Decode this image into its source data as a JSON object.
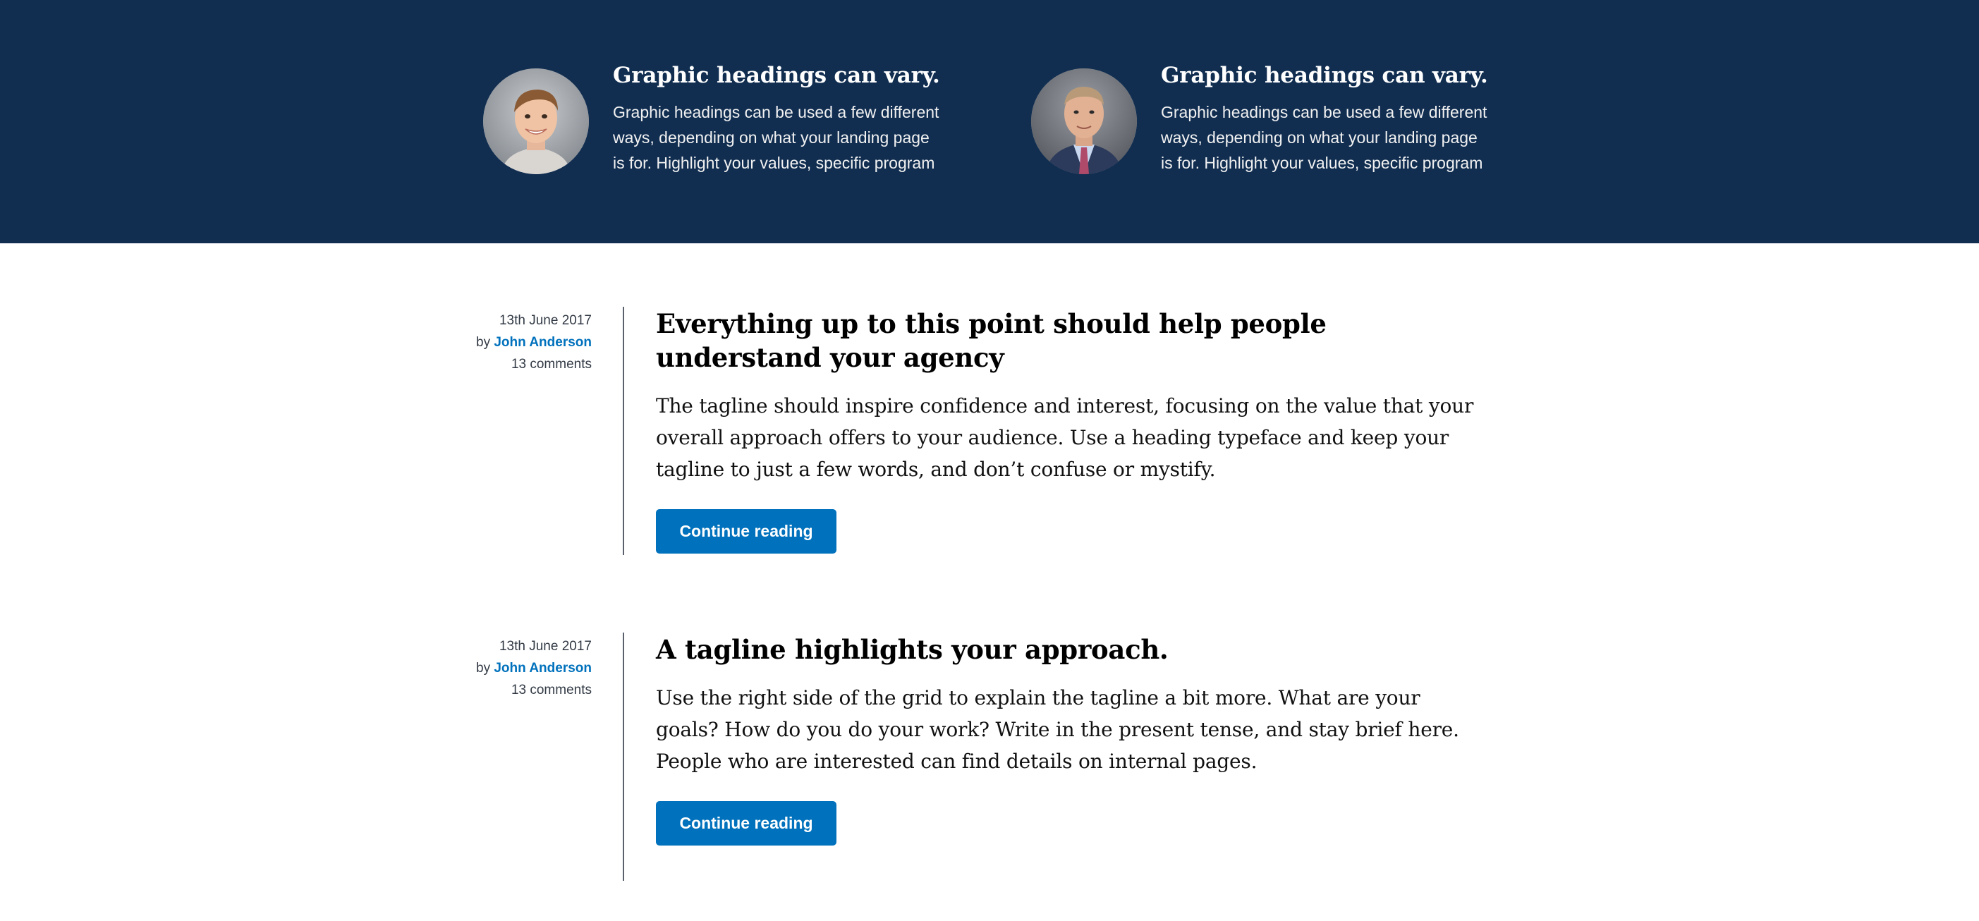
{
  "banner": {
    "people": [
      {
        "heading": "Graphic headings can vary.",
        "body": "Graphic headings can be used a few different ways, depending on what your landing page is for. Highlight your values, specific program",
        "avatar_icon": "person-photo-smiling-man"
      },
      {
        "heading": "Graphic headings can vary.",
        "body": "Graphic headings can be used a few different ways, depending on what your landing page is for. Highlight your values, specific program",
        "avatar_icon": "person-photo-man-in-suit"
      }
    ],
    "background_color": "#112e51"
  },
  "posts": [
    {
      "date": "13th June 2017",
      "by_prefix": "by",
      "author": "John Anderson",
      "comments": "13 comments",
      "title": "Everything up to this point should help people understand your agency",
      "excerpt": "The tagline should inspire confidence and interest, focusing on the value that your overall approach offers to your audience. Use a heading typeface and keep your tagline to just a few words, and don’t confuse or mystify.",
      "button_label": "Continue reading"
    },
    {
      "date": "13th June 2017",
      "by_prefix": "by",
      "author": "John Anderson",
      "comments": "13 comments",
      "title": "A tagline highlights your approach.",
      "excerpt": "Use the right side of the grid to explain the tagline a bit more. What are your goals? How do you do your work? Write in the present tense, and stay brief here. People who are interested can find details on internal pages.",
      "button_label": "Continue reading"
    }
  ],
  "colors": {
    "accent": "#0071bc",
    "banner": "#112e51"
  }
}
